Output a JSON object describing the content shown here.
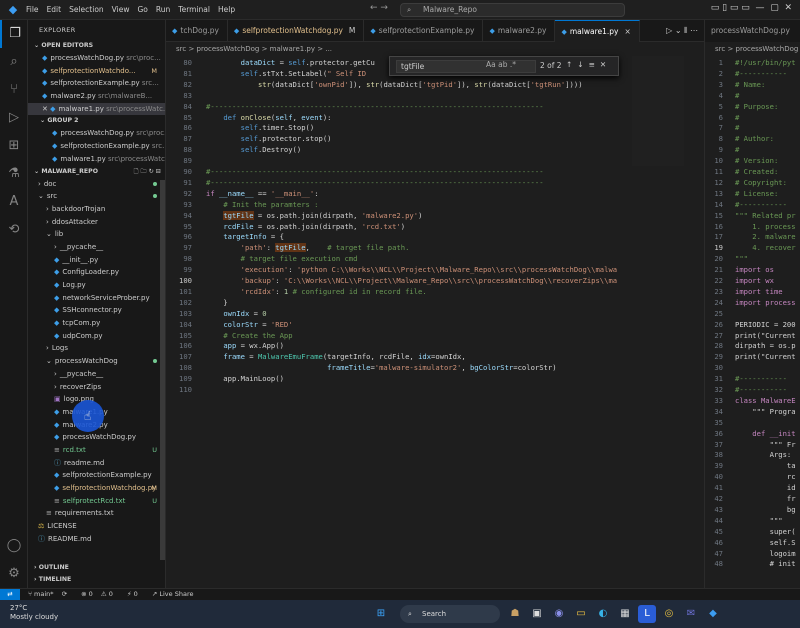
{
  "titlebar": {
    "menu": [
      "File",
      "Edit",
      "Selection",
      "View",
      "Go",
      "Run",
      "Terminal",
      "Help"
    ],
    "search": "Malware_Repo"
  },
  "sidebar": {
    "title": "EXPLORER",
    "open_editors_label": "OPEN EDITORS",
    "group2_label": "GROUP 2",
    "open_editors": [
      {
        "name": "processWatchDog.py",
        "path": "src\\proc...",
        "badge": ""
      },
      {
        "name": "selfprotectionWatchdo...",
        "path": "",
        "badge": "M"
      },
      {
        "name": "selfprotectionExample.py",
        "path": "src...",
        "badge": ""
      },
      {
        "name": "malware2.py",
        "path": "src\\malwareB...",
        "badge": ""
      },
      {
        "name": "malware1.py",
        "path": "src\\processWatc...",
        "badge": ""
      }
    ],
    "group2": [
      {
        "name": "processWatchDog.py",
        "path": "src\\proc..."
      },
      {
        "name": "selfprotectionExample.py",
        "path": "src..."
      },
      {
        "name": "malware1.py",
        "path": "src\\processWatc..."
      }
    ],
    "repo_label": "MALWARE_REPO",
    "tree": [
      {
        "name": "doc",
        "indent": 1,
        "type": "folder-closed",
        "badge": "dot"
      },
      {
        "name": "src",
        "indent": 1,
        "type": "folder-open",
        "badge": "dot"
      },
      {
        "name": "backdoorTrojan",
        "indent": 2,
        "type": "folder-closed",
        "badge": ""
      },
      {
        "name": "ddosAttacker",
        "indent": 2,
        "type": "folder-closed",
        "badge": ""
      },
      {
        "name": "lib",
        "indent": 2,
        "type": "folder-open",
        "badge": ""
      },
      {
        "name": "__pycache__",
        "indent": 3,
        "type": "folder-closed",
        "badge": ""
      },
      {
        "name": "__init__.py",
        "indent": 3,
        "type": "py",
        "badge": ""
      },
      {
        "name": "ConfigLoader.py",
        "indent": 3,
        "type": "py",
        "badge": ""
      },
      {
        "name": "Log.py",
        "indent": 3,
        "type": "py",
        "badge": ""
      },
      {
        "name": "networkServiceProber.py",
        "indent": 3,
        "type": "py",
        "badge": ""
      },
      {
        "name": "SSHconnector.py",
        "indent": 3,
        "type": "py",
        "badge": ""
      },
      {
        "name": "tcpCom.py",
        "indent": 3,
        "type": "py",
        "badge": ""
      },
      {
        "name": "udpCom.py",
        "indent": 3,
        "type": "py",
        "badge": ""
      },
      {
        "name": "Logs",
        "indent": 2,
        "type": "folder-closed",
        "badge": ""
      },
      {
        "name": "processWatchDog",
        "indent": 2,
        "type": "folder-open",
        "badge": "dot"
      },
      {
        "name": "__pycache__",
        "indent": 3,
        "type": "folder-closed",
        "badge": ""
      },
      {
        "name": "recoverZips",
        "indent": 3,
        "type": "folder-closed",
        "badge": ""
      },
      {
        "name": "logo.png",
        "indent": 3,
        "type": "img",
        "badge": ""
      },
      {
        "name": "malware1.py",
        "indent": 3,
        "type": "py",
        "badge": ""
      },
      {
        "name": "malware2.py",
        "indent": 3,
        "type": "py",
        "badge": ""
      },
      {
        "name": "processWatchDog.py",
        "indent": 3,
        "type": "py",
        "badge": ""
      },
      {
        "name": "rcd.txt",
        "indent": 3,
        "type": "txt",
        "badge": "U"
      },
      {
        "name": "readme.md",
        "indent": 3,
        "type": "md",
        "badge": ""
      },
      {
        "name": "selfprotectionExample.py",
        "indent": 3,
        "type": "py",
        "badge": ""
      },
      {
        "name": "selfprotectionWatchdog.py",
        "indent": 3,
        "type": "py",
        "badge": "M"
      },
      {
        "name": "selfprotectRcd.txt",
        "indent": 3,
        "type": "txt",
        "badge": "U"
      },
      {
        "name": "requirements.txt",
        "indent": 2,
        "type": "txt",
        "badge": ""
      },
      {
        "name": "LICENSE",
        "indent": 1,
        "type": "lic",
        "badge": ""
      },
      {
        "name": "README.md",
        "indent": 1,
        "type": "md",
        "badge": ""
      }
    ],
    "outline_label": "OUTLINE",
    "timeline_label": "TIMELINE"
  },
  "editor": {
    "tabs": [
      {
        "label": "tchDog.py",
        "badge": "",
        "active": false
      },
      {
        "label": "selfprotectionWatchdog.py",
        "badge": "M",
        "active": false
      },
      {
        "label": "selfprotectionExample.py",
        "badge": "",
        "active": false
      },
      {
        "label": "malware2.py",
        "badge": "",
        "active": false
      },
      {
        "label": "malware1.py",
        "badge": "×",
        "active": true
      }
    ],
    "breadcrumb": "src > processWatchDog > malware1.py > ...",
    "find": {
      "query": "tgtFile",
      "count": "2 of 2"
    },
    "lines": [
      {
        "n": "80",
        "html": "        <span class='vr'>dataDict</span> = <span class='kw'>self</span>.protector.getCu"
      },
      {
        "n": "81",
        "html": "        <span class='kw'>self</span>.stTxt.SetLabel(<span class='st'>\" Self ID</span>"
      },
      {
        "n": "82",
        "html": "            <span class='fn'>str</span>(dataDict[<span class='st'>'ownPid'</span>]), <span class='fn'>str</span>(dataDict[<span class='st'>'tgtPid'</span>]), <span class='fn'>str</span>(dataDict[<span class='st'>'tgtRun'</span>])))"
      },
      {
        "n": "83",
        "html": ""
      },
      {
        "n": "84",
        "html": "<span class='cm'>#-----------------------------------------------------------------------------</span>"
      },
      {
        "n": "85",
        "html": "    <span class='kw'>def</span> <span class='fn'>onClose</span>(<span class='vr'>self</span>, <span class='vr'>event</span>):"
      },
      {
        "n": "86",
        "html": "        <span class='kw'>self</span>.timer.Stop()"
      },
      {
        "n": "87",
        "html": "        <span class='kw'>self</span>.protector.stop()"
      },
      {
        "n": "88",
        "html": "        <span class='kw'>self</span>.Destroy()"
      },
      {
        "n": "89",
        "html": ""
      },
      {
        "n": "90",
        "html": "<span class='cm'>#-----------------------------------------------------------------------------</span>"
      },
      {
        "n": "91",
        "html": "<span class='cm'>#-----------------------------------------------------------------------------</span>"
      },
      {
        "n": "92",
        "html": "<span class='kc'>if</span> <span class='vr'>__name__</span> == <span class='st'>'__main__'</span>:"
      },
      {
        "n": "93",
        "html": "    <span class='cm'># Init the paramters :</span>"
      },
      {
        "n": "94",
        "html": "    <span class='vr hl'>tgtFile</span> = os.path.join(dirpath, <span class='st'>'malware2.py'</span>)"
      },
      {
        "n": "95",
        "html": "    <span class='vr'>rcdFile</span> = os.path.join(dirpath, <span class='st'>'rcd.txt'</span>)"
      },
      {
        "n": "96",
        "html": "    <span class='vr'>targetInfo</span> = {"
      },
      {
        "n": "97",
        "html": "        <span class='st'>'path'</span>: <span class='vr hl'>tgtFile</span>,    <span class='cm'># target file path.</span>"
      },
      {
        "n": "98",
        "html": "        <span class='cm'># target file execution cmd</span>"
      },
      {
        "n": "99",
        "html": "        <span class='st'>'execution'</span>: <span class='st'>'python C:\\\\Works\\\\NCL\\\\Project\\\\Malware_Repo\\\\src\\\\processWatchDog\\\\malwa</span>"
      },
      {
        "n": "100",
        "html": "        <span class='st'>'backup'</span>: <span class='st'>'C:\\\\Works\\\\NCL\\\\Project\\\\Malware_Repo\\\\src\\\\processWatchDog\\\\recoverZips\\\\ma</span>"
      },
      {
        "n": "101",
        "html": "        <span class='st'>'rcdIdx'</span>: <span class='nm'>1</span> <span class='cm'># configured id in record file.</span>"
      },
      {
        "n": "102",
        "html": "    }"
      },
      {
        "n": "103",
        "html": "    <span class='vr'>ownIdx</span> = <span class='nm'>0</span>"
      },
      {
        "n": "104",
        "html": "    <span class='vr'>colorStr</span> = <span class='st'>'RED'</span>"
      },
      {
        "n": "105",
        "html": "    <span class='cm'># Create the App</span>"
      },
      {
        "n": "106",
        "html": "    <span class='vr'>app</span> = wx.App()"
      },
      {
        "n": "107",
        "html": "    <span class='vr'>frame</span> = <span class='cls'>MalwareEmuFrame</span>(targetInfo, rcdFile, <span class='vr'>idx</span>=ownIdx,"
      },
      {
        "n": "108",
        "html": "                            <span class='vr'>frameTitle</span>=<span class='st'>'malware-simulator2'</span>, <span class='vr'>bgColorStr</span>=colorStr)"
      },
      {
        "n": "109",
        "html": "    app.MainLoop()"
      },
      {
        "n": "110",
        "html": ""
      }
    ]
  },
  "right_editor": {
    "tab": "processWatchDog.py",
    "breadcrumb": "src > processWatchDog",
    "lines": [
      {
        "n": "1",
        "t": "#!/usr/bin/pyt"
      },
      {
        "n": "2",
        "t": "#-----------"
      },
      {
        "n": "3",
        "t": "# Name:"
      },
      {
        "n": "4",
        "t": "#"
      },
      {
        "n": "5",
        "t": "# Purpose:"
      },
      {
        "n": "6",
        "t": "#"
      },
      {
        "n": "7",
        "t": "#"
      },
      {
        "n": "8",
        "t": "# Author:"
      },
      {
        "n": "9",
        "t": "#"
      },
      {
        "n": "10",
        "t": "# Version:"
      },
      {
        "n": "11",
        "t": "# Created:"
      },
      {
        "n": "12",
        "t": "# Copyright:"
      },
      {
        "n": "13",
        "t": "# License:"
      },
      {
        "n": "14",
        "t": "#-----------"
      },
      {
        "n": "15",
        "t": "\"\"\" Related pr"
      },
      {
        "n": "16",
        "t": "    1. process"
      },
      {
        "n": "17",
        "t": "    2. malware"
      },
      {
        "n": "19",
        "t": "    4. recover"
      },
      {
        "n": "20",
        "t": "\"\"\""
      },
      {
        "n": "21",
        "t": "import os"
      },
      {
        "n": "22",
        "t": "import wx"
      },
      {
        "n": "23",
        "t": "import time"
      },
      {
        "n": "24",
        "t": "import process"
      },
      {
        "n": "25",
        "t": ""
      },
      {
        "n": "26",
        "t": "PERIODIC = 200"
      },
      {
        "n": "27",
        "t": "print(\"Current"
      },
      {
        "n": "28",
        "t": "dirpath = os.p"
      },
      {
        "n": "29",
        "t": "print(\"Current"
      },
      {
        "n": "30",
        "t": ""
      },
      {
        "n": "31",
        "t": "#-----------"
      },
      {
        "n": "32",
        "t": "#-----------"
      },
      {
        "n": "33",
        "t": "class MalwareE"
      },
      {
        "n": "34",
        "t": "    \"\"\" Progra"
      },
      {
        "n": "35",
        "t": ""
      },
      {
        "n": "36",
        "t": "    def __init"
      },
      {
        "n": "37",
        "t": "        \"\"\" Fr"
      },
      {
        "n": "38",
        "t": "        Args:"
      },
      {
        "n": "39",
        "t": "            ta"
      },
      {
        "n": "40",
        "t": "            rc"
      },
      {
        "n": "41",
        "t": "            id"
      },
      {
        "n": "42",
        "t": "            fr"
      },
      {
        "n": "43",
        "t": "            bg"
      },
      {
        "n": "44",
        "t": "        \"\"\""
      },
      {
        "n": "45",
        "t": "        super("
      },
      {
        "n": "46",
        "t": "        self.S"
      },
      {
        "n": "47",
        "t": "        logoim"
      },
      {
        "n": "48",
        "t": "        # init"
      }
    ]
  },
  "status": {
    "branch": "main*",
    "sync": "⟳",
    "errors": "0",
    "warnings": "0",
    "ports": "0",
    "live_share": "Live Share"
  },
  "taskbar": {
    "temp": "27°C",
    "weather": "Mostly cloudy",
    "search": "Search"
  }
}
